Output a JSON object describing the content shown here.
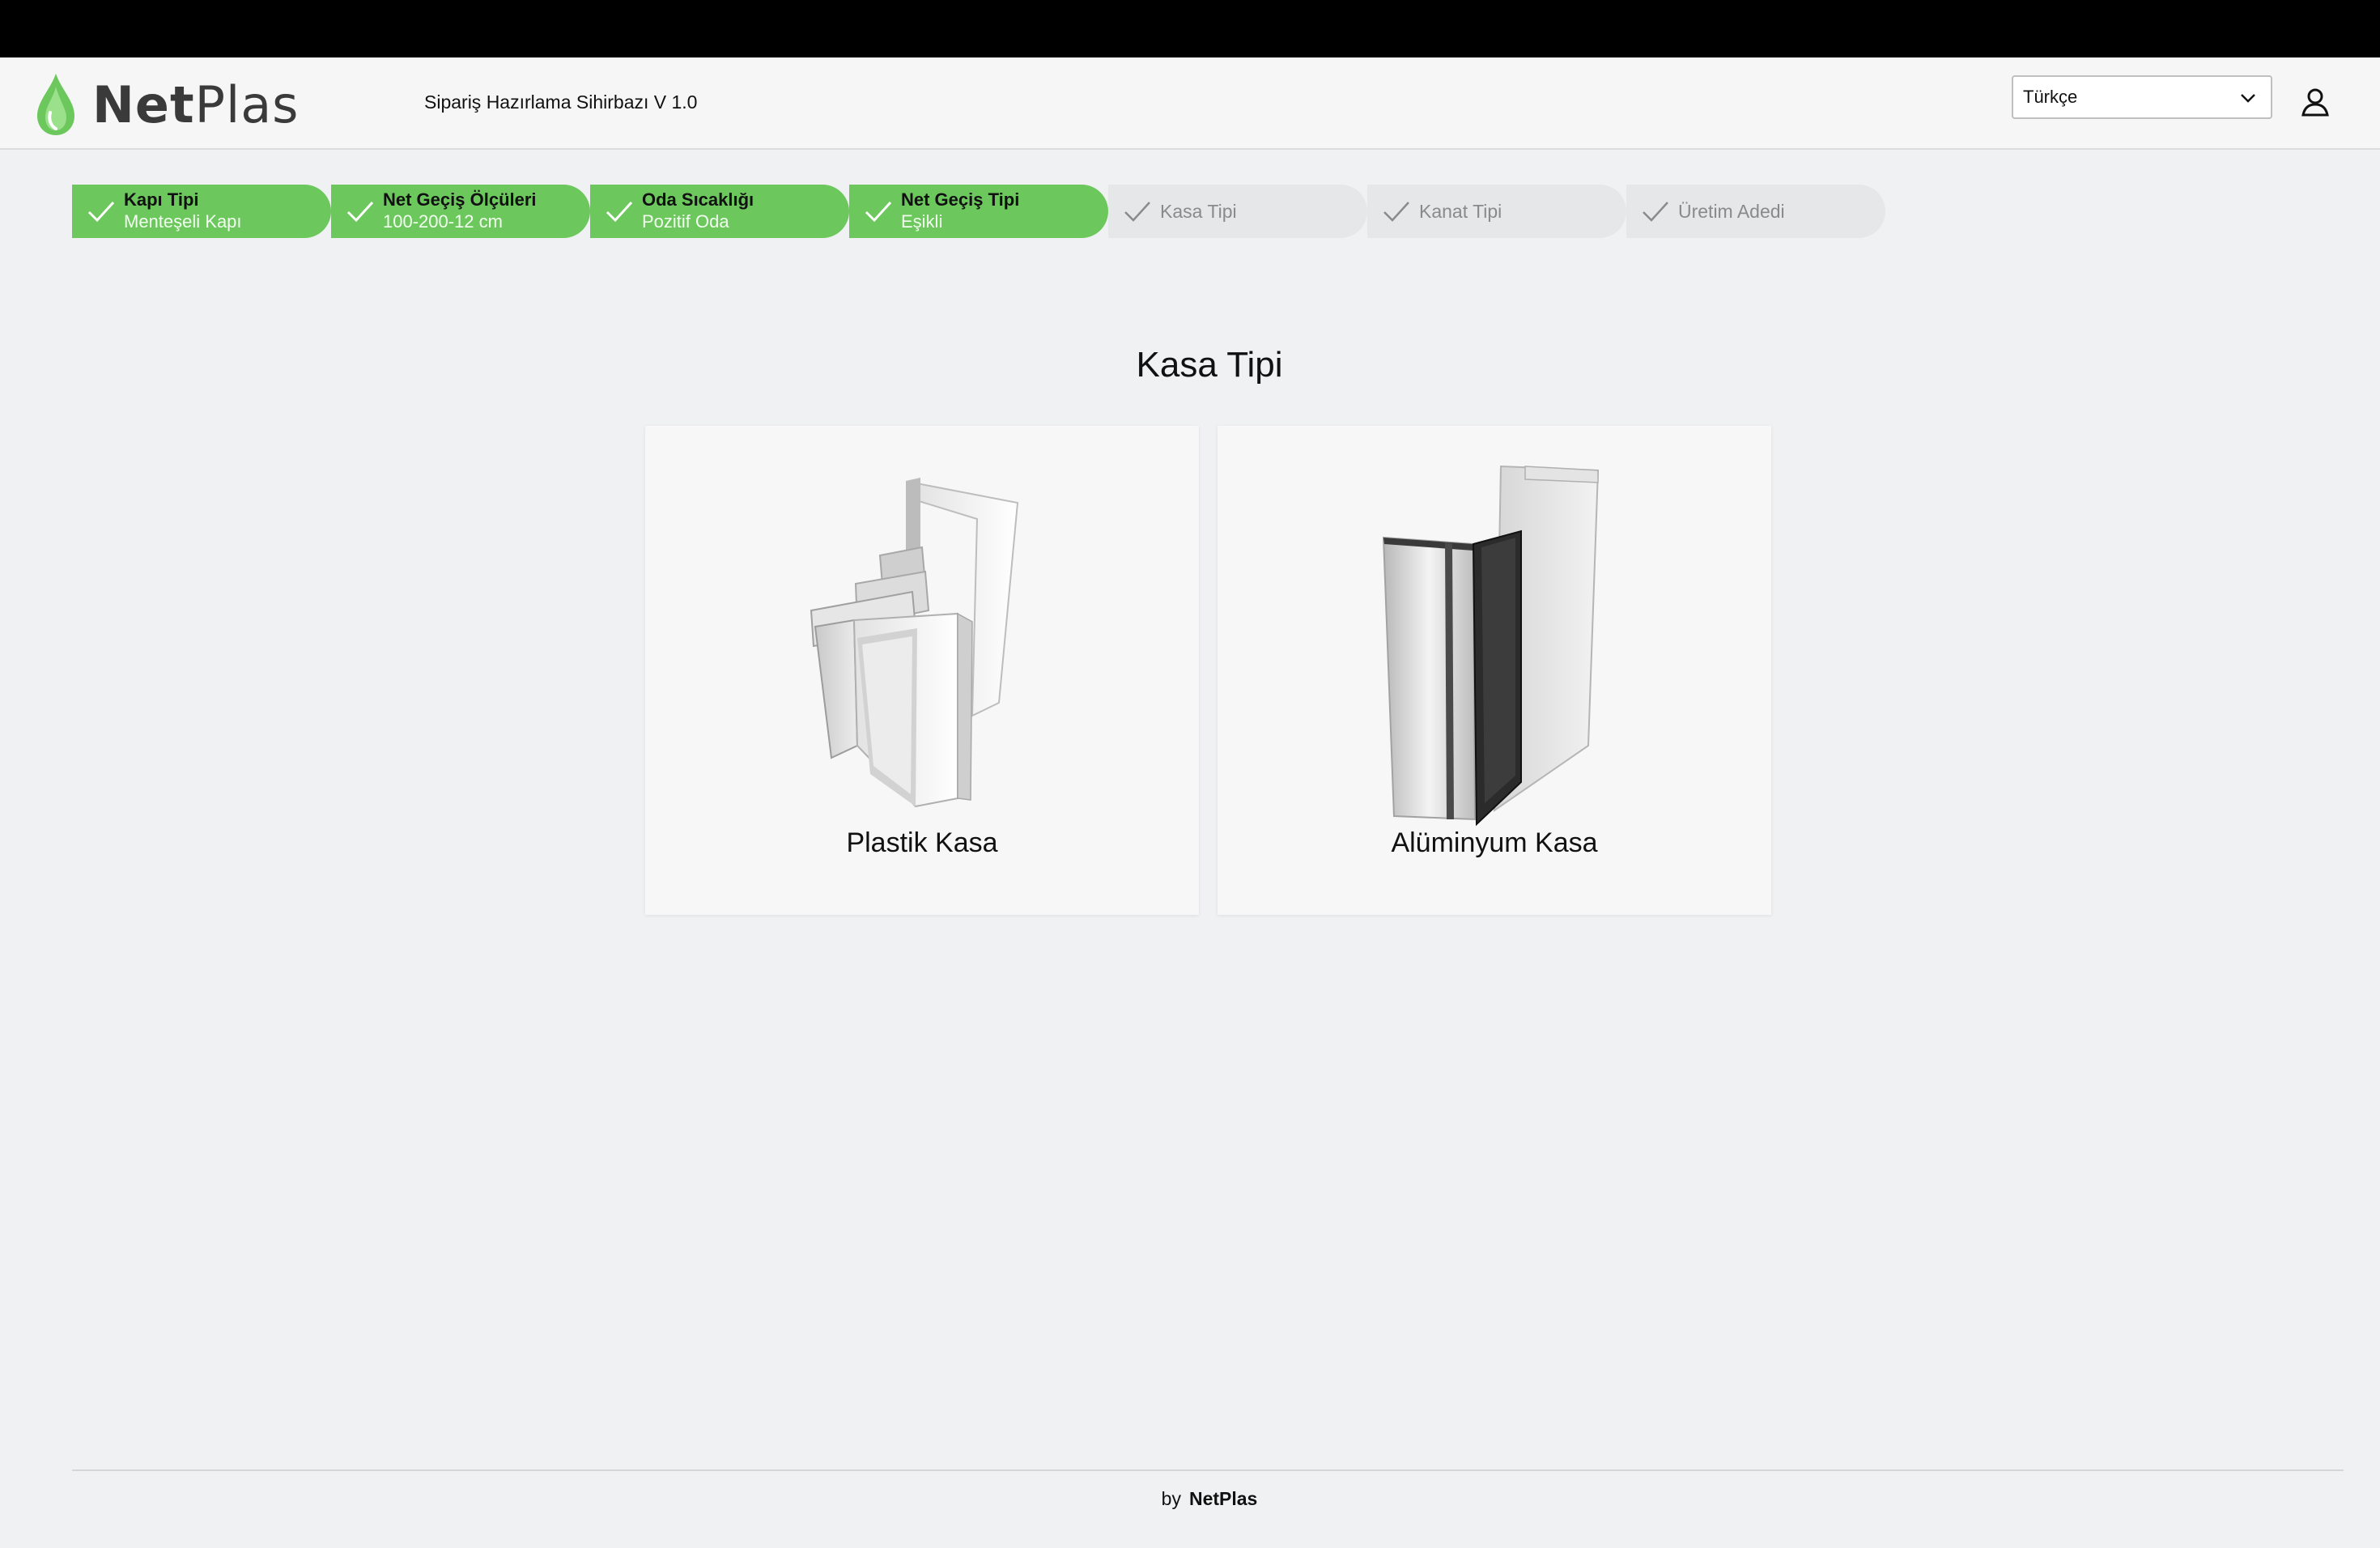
{
  "header": {
    "logo_bold": "Net",
    "logo_light": "Plas",
    "wizard_title": "Sipariş Hazırlama Sihirbazı V 1.0",
    "language": {
      "selected": "Türkçe"
    },
    "icons": {
      "logo": "leaf-drop-logo-icon",
      "dropdown": "chevron-down-icon",
      "user": "user-icon"
    }
  },
  "steps": [
    {
      "label": "Kapı Tipi",
      "value": "Menteşeli Kapı",
      "state": "done"
    },
    {
      "label": "Net Geçiş Ölçüleri",
      "value": "100-200-12 cm",
      "state": "done"
    },
    {
      "label": "Oda Sıcaklığı",
      "value": "Pozitif Oda",
      "state": "done"
    },
    {
      "label": "Net Geçiş Tipi",
      "value": "Eşikli",
      "state": "done"
    },
    {
      "label": "Kasa Tipi",
      "state": "todo"
    },
    {
      "label": "Kanat Tipi",
      "state": "todo"
    },
    {
      "label": "Üretim Adedi",
      "state": "todo"
    }
  ],
  "main": {
    "title": "Kasa Tipi",
    "options": [
      {
        "label": "Plastik Kasa"
      },
      {
        "label": "Alüminyum Kasa"
      }
    ]
  },
  "footer": {
    "by": "by",
    "brand": "NetPlas"
  },
  "colors": {
    "done": "#6cc75d",
    "todo": "#e6e7e8",
    "accent_dark": "#3a3a3a"
  }
}
